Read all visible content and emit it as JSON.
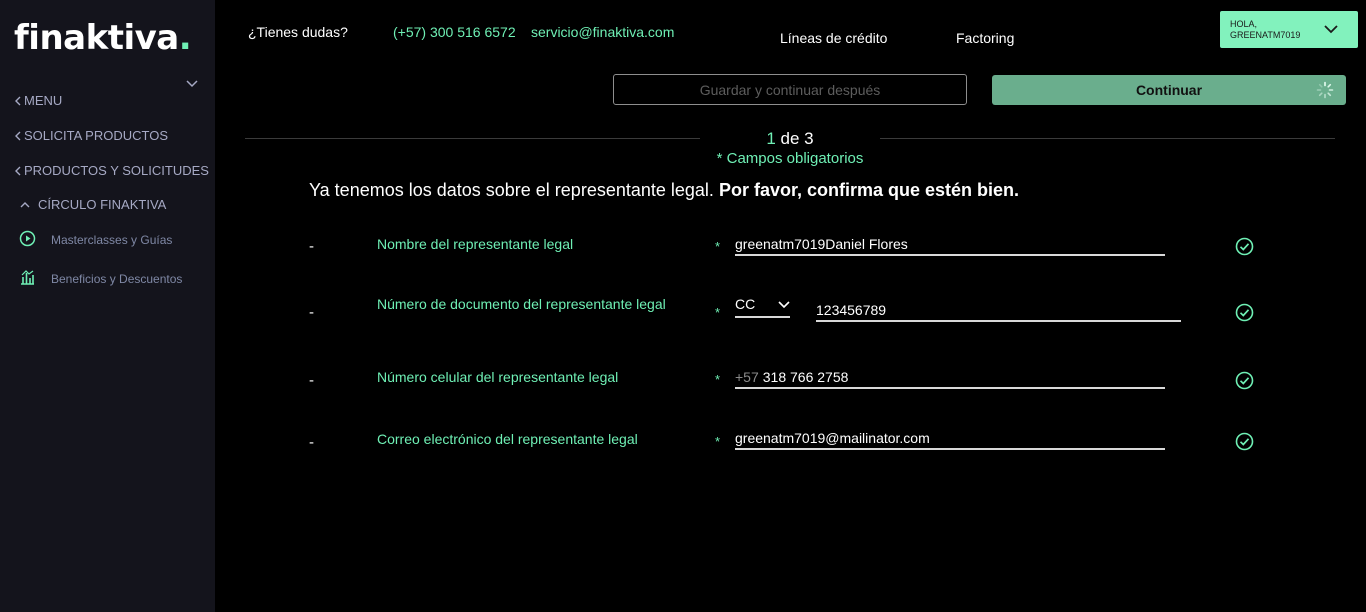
{
  "brand": {
    "name": "finaktiva",
    "dot": ".",
    "accent": "#6ff0b5"
  },
  "sidebar": {
    "menu_label": "MENU",
    "items": [
      {
        "label": "SOLICITA PRODUCTOS"
      },
      {
        "label": "PRODUCTOS Y SOLICITUDES"
      },
      {
        "label": "CÍRCULO FINAKTIVA"
      }
    ],
    "subitems": [
      {
        "label": "Masterclasses y Guías",
        "icon": "play-circle-icon"
      },
      {
        "label": "Beneficios y Descuentos",
        "icon": "chart-bars-icon"
      }
    ]
  },
  "header": {
    "help": "¿Tienes dudas?",
    "phone": "(+57) 300 516 6572",
    "email": "servicio@finaktiva.com",
    "nav": [
      "Líneas de crédito",
      "Factoring"
    ],
    "user_greeting": "HOLA,",
    "user_name": "GREENATM7019"
  },
  "actions": {
    "save_later": "Guardar y continuar después",
    "continue": "Continuar"
  },
  "progress": {
    "current": "1",
    "separator": " de 3"
  },
  "required_note": "* Campos obligatorios",
  "intro": {
    "text": "Ya tenemos los datos sobre el representante legal.",
    "bold": "Por favor, confirma que estén bien."
  },
  "fields": [
    {
      "dash": "-",
      "label": "Nombre del representante legal",
      "star": "*",
      "value": "greenatm7019Daniel Flores"
    },
    {
      "dash": "-",
      "label": "Número de documento del representante legal",
      "star": "*",
      "doc_type": "CC",
      "value": "123456789"
    },
    {
      "dash": "-",
      "label": "Número celular del representante legal",
      "star": "*",
      "prefix": "+57",
      "value": "318 766 2758"
    },
    {
      "dash": "-",
      "label": "Correo electrónico del representante legal",
      "star": "*",
      "value": "greenatm7019@mailinator.com"
    }
  ]
}
